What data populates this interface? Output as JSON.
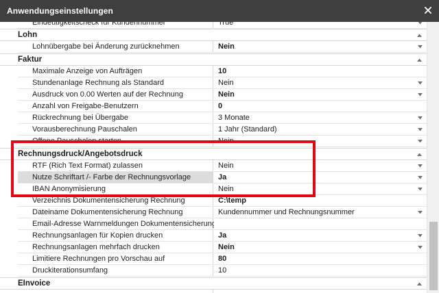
{
  "window": {
    "title": "Anwendungseinstellungen"
  },
  "partial_top_row": {
    "label": "Eindeutigkeitscheck für Kundennummer",
    "value": "True"
  },
  "sections": [
    {
      "name": "Lohn",
      "rows": [
        {
          "label": "Lohnübergabe bei Änderung zurücknehmen",
          "value": "Nein",
          "bold": true,
          "dropdown": true
        }
      ]
    },
    {
      "name": "Faktur",
      "rows": [
        {
          "label": "Maximale Anzeige von Aufträgen",
          "value": "10",
          "bold": true,
          "dropdown": false
        },
        {
          "label": "Stundenanlage Rechnung als Standard",
          "value": "Nein",
          "bold": false,
          "dropdown": true
        },
        {
          "label": "Ausdruck von 0.00 Werten auf der Rechnung",
          "value": "Nein",
          "bold": true,
          "dropdown": true
        },
        {
          "label": "Anzahl von Freigabe-Benutzern",
          "value": "0",
          "bold": true,
          "dropdown": false
        },
        {
          "label": "Rückrechnung bei Übergabe",
          "value": "3 Monate",
          "bold": false,
          "dropdown": true
        },
        {
          "label": "Vorausberechnung Pauschalen",
          "value": "1 Jahr (Standard)",
          "bold": false,
          "dropdown": true
        },
        {
          "label": "Offene Pauschalen starten",
          "value": "Nein",
          "bold": false,
          "dropdown": true
        }
      ]
    },
    {
      "name": "Rechnungsdruck/Angebotsdruck",
      "rows": [
        {
          "label": "RTF (Rich Text Format) zulassen",
          "value": "Nein",
          "bold": false,
          "dropdown": true
        },
        {
          "label": "Nutze Schriftart /- Farbe der Rechnungsvorlage",
          "value": "Ja",
          "bold": true,
          "dropdown": true,
          "highlight": true
        },
        {
          "label": "IBAN Anonymisierung",
          "value": "Nein",
          "bold": false,
          "dropdown": true
        },
        {
          "label": "Verzeichnis Dokumentensicherung Rechnung",
          "value": "C:\\temp",
          "bold": true,
          "dropdown": false
        },
        {
          "label": "Dateiname Dokumentensicherung Rechnung",
          "value": "Kundennummer und Rechnungsnummer",
          "bold": false,
          "dropdown": true
        },
        {
          "label": "Email-Adresse Warnmeldungen Dokumentensicherung",
          "value": "",
          "bold": false,
          "dropdown": false
        },
        {
          "label": "Rechnungsanlagen für Kopien drucken",
          "value": "Ja",
          "bold": true,
          "dropdown": true
        },
        {
          "label": "Rechnungsanlagen mehrfach drucken",
          "value": "Nein",
          "bold": true,
          "dropdown": true
        },
        {
          "label": "Limitiere Rechnungen pro Vorschau auf",
          "value": "80",
          "bold": true,
          "dropdown": false
        },
        {
          "label": "Druckiterationsumfang",
          "value": "10",
          "bold": false,
          "dropdown": false
        }
      ]
    },
    {
      "name": "EInvoice",
      "rows": []
    }
  ],
  "colors": {
    "titlebar": "#3f3f3f",
    "highlight_box": "#e30613",
    "label_highlight": "#dcdcdc"
  },
  "icons": {
    "close": "close-icon",
    "collapse": "chevron-up-icon",
    "dropdown": "chevron-down-icon"
  }
}
